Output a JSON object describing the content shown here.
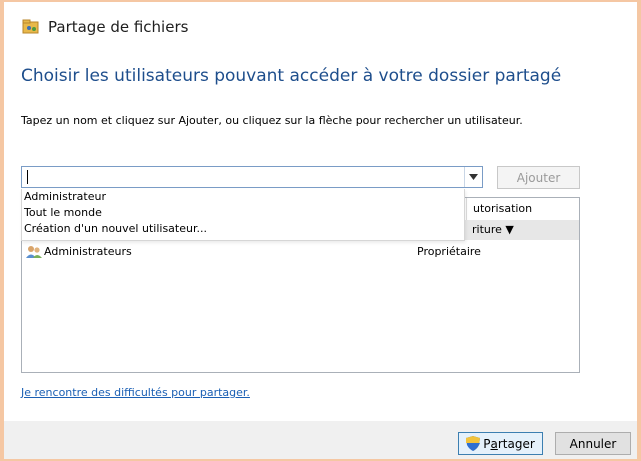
{
  "window": {
    "title": "Partage de fichiers",
    "app_icon": "share-folder-icon"
  },
  "heading": "Choisir les utilisateurs pouvant accéder à votre dossier partagé",
  "instruction": "Tapez un nom et cliquez sur Ajouter, ou cliquez sur la flèche pour rechercher un utilisateur.",
  "combo": {
    "value": "",
    "dropdown_icon": "chevron-down-icon"
  },
  "add_button": {
    "label_pre": "A",
    "label_accel": "j",
    "label_post": "outer"
  },
  "dropdown_options": [
    "Administrateur",
    "Tout le monde",
    "Création d'un nouvel utilisateur..."
  ],
  "table": {
    "col_permission": "utorisation",
    "subrow_permission": "riture ▼",
    "rows": [
      {
        "name": "Administrateurs",
        "permission": "Propriétaire",
        "icon": "user-group-icon"
      }
    ]
  },
  "help_link": "Je rencontre des difficultés pour partager.",
  "footer": {
    "share_pre": "P",
    "share_accel": "a",
    "share_post": "rtager",
    "cancel": "Annuler",
    "share_icon": "shield-icon"
  },
  "colors": {
    "accent_heading": "#1e4e8c",
    "link": "#1a5fb4",
    "frame": "#f5c7a3"
  }
}
